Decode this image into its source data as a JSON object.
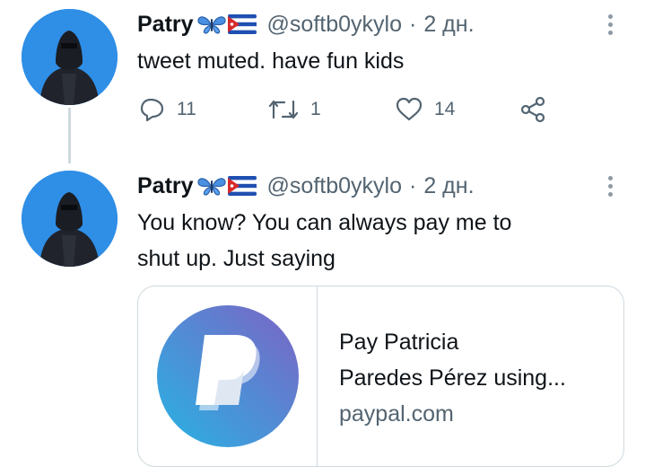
{
  "tweets": [
    {
      "name": "Patry",
      "flags": [
        "butterfly-emoji",
        "cuba-flag"
      ],
      "handle": "@softb0ykylo",
      "separator": "·",
      "time": "2 дн.",
      "text": "tweet muted. have fun kids",
      "actions": {
        "replies": "11",
        "retweets": "1",
        "likes": "14"
      }
    },
    {
      "name": "Patry",
      "flags": [
        "butterfly-emoji",
        "cuba-flag"
      ],
      "handle": "@softb0ykylo",
      "separator": "·",
      "time": "2 дн.",
      "text_lines": [
        "You know? You can always pay me to",
        "shut up. Just saying"
      ],
      "card": {
        "icon": "paypal-logo",
        "title_lines": [
          "Pay Patricia",
          "Paredes Pérez using..."
        ],
        "domain": "paypal.com"
      }
    }
  ],
  "colors": {
    "primary_text": "#0f1419",
    "secondary_text": "#536471",
    "border": "#cfd9de",
    "avatar_bg": "#2f8ee6"
  }
}
